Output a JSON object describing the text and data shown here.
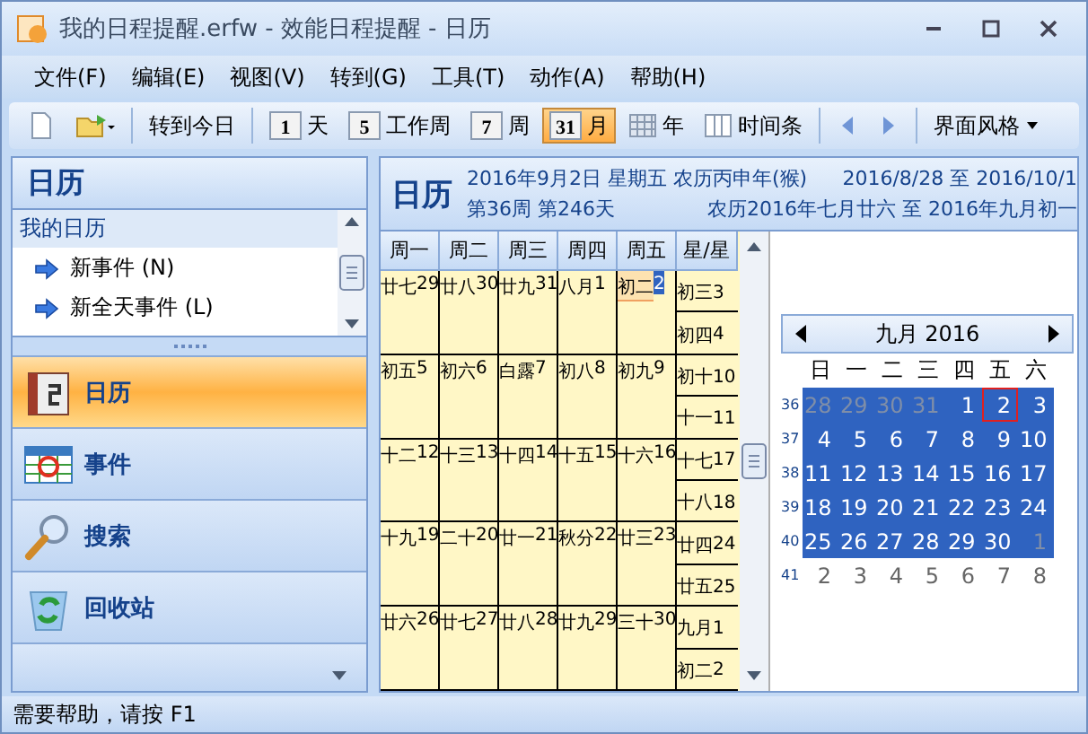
{
  "window": {
    "title": "我的日程提醒.erfw - 效能日程提醒 - 日历"
  },
  "menu": [
    "文件(F)",
    "编辑(E)",
    "视图(V)",
    "转到(G)",
    "工具(T)",
    "动作(A)",
    "帮助(H)"
  ],
  "toolbar": [
    {
      "kind": "new"
    },
    {
      "kind": "open"
    },
    {
      "kind": "text",
      "label": "转到今日"
    },
    {
      "kind": "view",
      "badge": "1",
      "label": "天",
      "selected": false
    },
    {
      "kind": "view",
      "badge": "5",
      "label": "工作周",
      "selected": false
    },
    {
      "kind": "view",
      "badge": "7",
      "label": "周",
      "selected": false
    },
    {
      "kind": "view",
      "badge": "31",
      "label": "月",
      "selected": true
    },
    {
      "kind": "gridview",
      "label": "年",
      "selected": false
    },
    {
      "kind": "columnview",
      "label": "时间条",
      "selected": false
    },
    {
      "kind": "back"
    },
    {
      "kind": "forward"
    },
    {
      "kind": "menu",
      "label": "界面风格"
    }
  ],
  "sidebar": {
    "title": "日历",
    "tree_title": "我的日历",
    "links": [
      "新事件 (N)",
      "新全天事件 (L)"
    ],
    "nav": [
      {
        "label": "日历",
        "selected": true
      },
      {
        "label": "事件",
        "selected": false
      },
      {
        "label": "搜索",
        "selected": false
      },
      {
        "label": "回收站",
        "selected": false
      }
    ]
  },
  "calendar": {
    "title": "日历",
    "line_1": "2016年9月2日 星期五 农历丙申年(猴)",
    "range_1": "2016/8/28 至 2016/10/1",
    "line_2": "第36周 第246天",
    "range_2": "农历2016年七月廿六 至 2016年九月初一",
    "weekdays": [
      "周一",
      "周二",
      "周三",
      "周四",
      "周五",
      "星/星"
    ],
    "weeks": [
      [
        {
          "lunar": "廿七",
          "day": "29",
          "today": false
        },
        {
          "lunar": "廿八",
          "day": "30",
          "today": false
        },
        {
          "lunar": "廿九",
          "day": "31",
          "today": false
        },
        {
          "lunar": "八月",
          "day": "1",
          "today": false
        },
        {
          "lunar": "初二",
          "day": "2",
          "today": true
        },
        {
          "lunar": "初三",
          "day": "3",
          "today": false
        },
        {
          "lunar": "初四",
          "day": "4",
          "today": false
        }
      ],
      [
        {
          "lunar": "初五",
          "day": "5",
          "today": false
        },
        {
          "lunar": "初六",
          "day": "6",
          "today": false
        },
        {
          "lunar": "白露",
          "day": "7",
          "today": false
        },
        {
          "lunar": "初八",
          "day": "8",
          "today": false
        },
        {
          "lunar": "初九",
          "day": "9",
          "today": false
        },
        {
          "lunar": "初十",
          "day": "10",
          "today": false
        },
        {
          "lunar": "十一",
          "day": "11",
          "today": false
        }
      ],
      [
        {
          "lunar": "十二",
          "day": "12",
          "today": false
        },
        {
          "lunar": "十三",
          "day": "13",
          "today": false
        },
        {
          "lunar": "十四",
          "day": "14",
          "today": false
        },
        {
          "lunar": "十五",
          "day": "15",
          "today": false
        },
        {
          "lunar": "十六",
          "day": "16",
          "today": false
        },
        {
          "lunar": "十七",
          "day": "17",
          "today": false
        },
        {
          "lunar": "十八",
          "day": "18",
          "today": false
        }
      ],
      [
        {
          "lunar": "十九",
          "day": "19",
          "today": false
        },
        {
          "lunar": "二十",
          "day": "20",
          "today": false
        },
        {
          "lunar": "廿一",
          "day": "21",
          "today": false
        },
        {
          "lunar": "秋分",
          "day": "22",
          "today": false
        },
        {
          "lunar": "廿三",
          "day": "23",
          "today": false
        },
        {
          "lunar": "廿四",
          "day": "24",
          "today": false
        },
        {
          "lunar": "廿五",
          "day": "25",
          "today": false
        }
      ],
      [
        {
          "lunar": "廿六",
          "day": "26",
          "today": false
        },
        {
          "lunar": "廿七",
          "day": "27",
          "today": false
        },
        {
          "lunar": "廿八",
          "day": "28",
          "today": false
        },
        {
          "lunar": "廿九",
          "day": "29",
          "today": false
        },
        {
          "lunar": "三十",
          "day": "30",
          "today": false
        },
        {
          "lunar": "九月",
          "day": "1",
          "today": false
        },
        {
          "lunar": "初二",
          "day": "2",
          "today": false
        }
      ]
    ]
  },
  "mini_calendar": {
    "title": "九月 2016",
    "weekdays": [
      "日",
      "一",
      "二",
      "三",
      "四",
      "五",
      "六"
    ],
    "weeks": [
      {
        "number": "36",
        "days": [
          {
            "day": "28",
            "muted": true,
            "highlighted": true,
            "selected": false
          },
          {
            "day": "29",
            "muted": true,
            "highlighted": true,
            "selected": false
          },
          {
            "day": "30",
            "muted": true,
            "highlighted": true,
            "selected": false
          },
          {
            "day": "31",
            "muted": true,
            "highlighted": true,
            "selected": false
          },
          {
            "day": "1",
            "muted": false,
            "highlighted": true,
            "selected": false
          },
          {
            "day": "2",
            "muted": false,
            "highlighted": true,
            "selected": true
          },
          {
            "day": "3",
            "muted": false,
            "highlighted": true,
            "selected": false
          }
        ]
      },
      {
        "number": "37",
        "days": [
          {
            "day": "4",
            "muted": false,
            "highlighted": true,
            "selected": false
          },
          {
            "day": "5",
            "muted": false,
            "highlighted": true,
            "selected": false
          },
          {
            "day": "6",
            "muted": false,
            "highlighted": true,
            "selected": false
          },
          {
            "day": "7",
            "muted": false,
            "highlighted": true,
            "selected": false
          },
          {
            "day": "8",
            "muted": false,
            "highlighted": true,
            "selected": false
          },
          {
            "day": "9",
            "muted": false,
            "highlighted": true,
            "selected": false
          },
          {
            "day": "10",
            "muted": false,
            "highlighted": true,
            "selected": false
          }
        ]
      },
      {
        "number": "38",
        "days": [
          {
            "day": "11",
            "muted": false,
            "highlighted": true,
            "selected": false
          },
          {
            "day": "12",
            "muted": false,
            "highlighted": true,
            "selected": false
          },
          {
            "day": "13",
            "muted": false,
            "highlighted": true,
            "selected": false
          },
          {
            "day": "14",
            "muted": false,
            "highlighted": true,
            "selected": false
          },
          {
            "day": "15",
            "muted": false,
            "highlighted": true,
            "selected": false
          },
          {
            "day": "16",
            "muted": false,
            "highlighted": true,
            "selected": false
          },
          {
            "day": "17",
            "muted": false,
            "highlighted": true,
            "selected": false
          }
        ]
      },
      {
        "number": "39",
        "days": [
          {
            "day": "18",
            "muted": false,
            "highlighted": true,
            "selected": false
          },
          {
            "day": "19",
            "muted": false,
            "highlighted": true,
            "selected": false
          },
          {
            "day": "20",
            "muted": false,
            "highlighted": true,
            "selected": false
          },
          {
            "day": "21",
            "muted": false,
            "highlighted": true,
            "selected": false
          },
          {
            "day": "22",
            "muted": false,
            "highlighted": true,
            "selected": false
          },
          {
            "day": "23",
            "muted": false,
            "highlighted": true,
            "selected": false
          },
          {
            "day": "24",
            "muted": false,
            "highlighted": true,
            "selected": false
          }
        ]
      },
      {
        "number": "40",
        "days": [
          {
            "day": "25",
            "muted": false,
            "highlighted": true,
            "selected": false
          },
          {
            "day": "26",
            "muted": false,
            "highlighted": true,
            "selected": false
          },
          {
            "day": "27",
            "muted": false,
            "highlighted": true,
            "selected": false
          },
          {
            "day": "28",
            "muted": false,
            "highlighted": true,
            "selected": false
          },
          {
            "day": "29",
            "muted": false,
            "highlighted": true,
            "selected": false
          },
          {
            "day": "30",
            "muted": false,
            "highlighted": true,
            "selected": false
          },
          {
            "day": "1",
            "muted": true,
            "highlighted": true,
            "selected": false
          }
        ]
      },
      {
        "number": "41",
        "days": [
          {
            "day": "2",
            "muted": true,
            "highlighted": false,
            "selected": false
          },
          {
            "day": "3",
            "muted": true,
            "highlighted": false,
            "selected": false
          },
          {
            "day": "4",
            "muted": true,
            "highlighted": false,
            "selected": false
          },
          {
            "day": "5",
            "muted": true,
            "highlighted": false,
            "selected": false
          },
          {
            "day": "6",
            "muted": true,
            "highlighted": false,
            "selected": false
          },
          {
            "day": "7",
            "muted": true,
            "highlighted": false,
            "selected": false
          },
          {
            "day": "8",
            "muted": true,
            "highlighted": false,
            "selected": false
          }
        ]
      }
    ]
  },
  "status_bar": "需要帮助，请按 F1"
}
